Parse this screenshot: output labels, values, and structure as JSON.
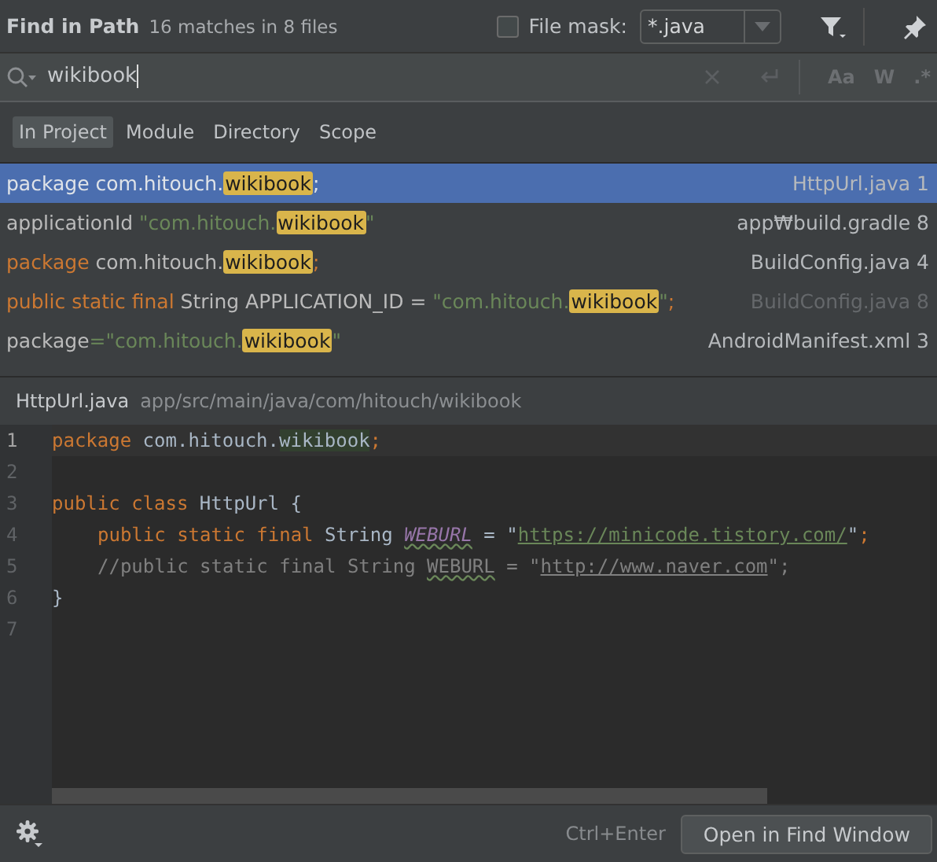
{
  "header": {
    "title": "Find in Path",
    "summary": "16 matches in 8 files",
    "file_mask": {
      "checked": false,
      "label": "File mask:",
      "value": "*.java"
    }
  },
  "search": {
    "value": "wikibook",
    "options": [
      "Aa",
      "W",
      ".*"
    ]
  },
  "scopes": [
    {
      "label": "In Project",
      "selected": true
    },
    {
      "label": "Module",
      "selected": false
    },
    {
      "label": "Directory",
      "selected": false
    },
    {
      "label": "Scope",
      "selected": false
    }
  ],
  "results": [
    {
      "selected": true,
      "dimmed": false,
      "file": "HttpUrl.java 1",
      "parts": [
        {
          "kind": "plain",
          "text": "package com.hitouch."
        },
        {
          "kind": "match",
          "text": "wikibook"
        },
        {
          "kind": "plain",
          "text": ";"
        }
      ]
    },
    {
      "selected": false,
      "dimmed": false,
      "file": "app₩build.gradle 8",
      "parts": [
        {
          "kind": "plain",
          "text": "applicationId "
        },
        {
          "kind": "str",
          "text": "\"com.hitouch."
        },
        {
          "kind": "match",
          "text": "wikibook"
        },
        {
          "kind": "str",
          "text": "\""
        }
      ]
    },
    {
      "selected": false,
      "dimmed": false,
      "file": "BuildConfig.java 4",
      "parts": [
        {
          "kind": "kw",
          "text": "package "
        },
        {
          "kind": "plain",
          "text": "com.hitouch."
        },
        {
          "kind": "match",
          "text": "wikibook"
        },
        {
          "kind": "kw",
          "text": ";"
        }
      ]
    },
    {
      "selected": false,
      "dimmed": true,
      "file": "BuildConfig.java 8",
      "parts": [
        {
          "kind": "kw",
          "text": "public static final "
        },
        {
          "kind": "plain",
          "text": "String APPLICATION_ID = "
        },
        {
          "kind": "str",
          "text": "\"com.hitouch."
        },
        {
          "kind": "match",
          "text": "wikibook"
        },
        {
          "kind": "str",
          "text": "\""
        },
        {
          "kind": "kw",
          "text": ";"
        }
      ]
    },
    {
      "selected": false,
      "dimmed": false,
      "file": "AndroidManifest.xml 3",
      "parts": [
        {
          "kind": "plain",
          "text": "package"
        },
        {
          "kind": "str",
          "text": "=\"com.hitouch."
        },
        {
          "kind": "match",
          "text": "wikibook"
        },
        {
          "kind": "str",
          "text": "\""
        }
      ]
    }
  ],
  "preview": {
    "file": "HttpUrl.java",
    "path": "app/src/main/java/com/hitouch/wikibook",
    "lines": [
      {
        "number": "1",
        "current": true,
        "tokens": [
          {
            "kind": "kw",
            "text": "package "
          },
          {
            "kind": "plain",
            "text": "com.hitouch."
          },
          {
            "kind": "match",
            "text": "wikibook"
          },
          {
            "kind": "kw",
            "text": ";"
          }
        ]
      },
      {
        "number": "2",
        "current": false
      },
      {
        "number": "3",
        "current": false,
        "tokens": [
          {
            "kind": "kw",
            "text": "public class "
          },
          {
            "kind": "plain",
            "text": "HttpUrl {"
          }
        ]
      },
      {
        "number": "4",
        "current": false,
        "indent": true,
        "tokens": [
          {
            "kind": "kw",
            "text": "public static final "
          },
          {
            "kind": "plain",
            "text": "String "
          },
          {
            "kind": "field",
            "text": "WEBURL"
          },
          {
            "kind": "plain",
            "text": " = \""
          },
          {
            "kind": "link",
            "text": "https://minicode.tistory.com/"
          },
          {
            "kind": "plain",
            "text": "\""
          },
          {
            "kind": "kw",
            "text": ";"
          }
        ]
      },
      {
        "number": "5",
        "current": false,
        "indent": true,
        "tokens": [
          {
            "kind": "comment",
            "text": "//public static final String "
          },
          {
            "kind": "typo",
            "text": "WEBURL"
          },
          {
            "kind": "comment",
            "text": " = \""
          },
          {
            "kind": "clink",
            "text": "http://www.naver.com"
          },
          {
            "kind": "comment",
            "text": "\";"
          }
        ]
      },
      {
        "number": "6",
        "current": false,
        "tokens": [
          {
            "kind": "plain",
            "text": "}"
          }
        ]
      },
      {
        "number": "7",
        "current": false
      }
    ]
  },
  "footer": {
    "shortcut": "Ctrl+Enter",
    "button": "Open in Find Window"
  }
}
